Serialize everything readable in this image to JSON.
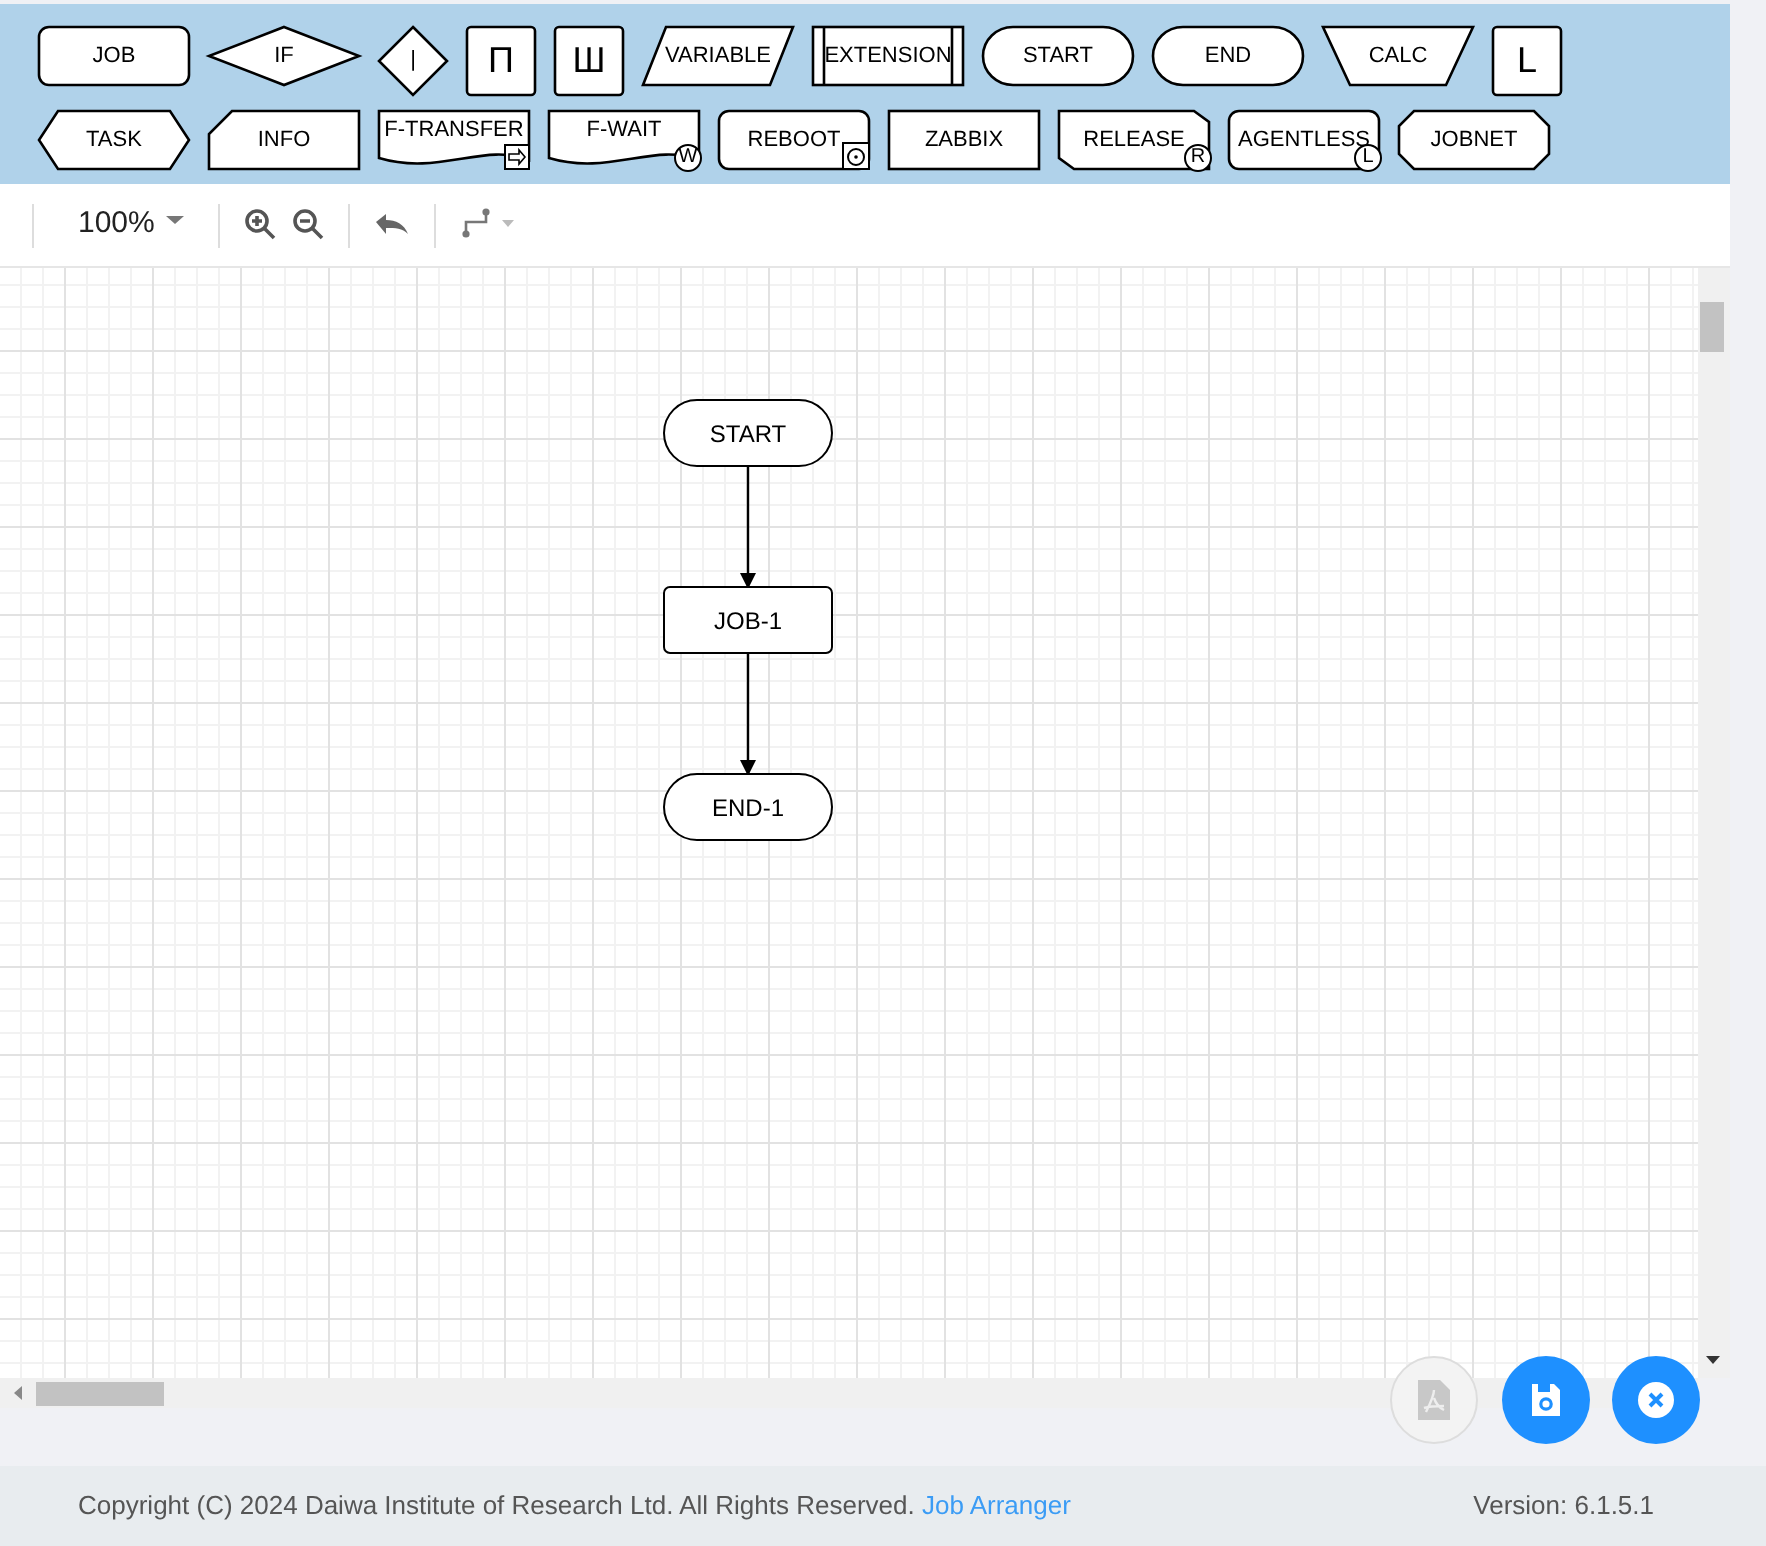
{
  "palette": {
    "top_row": [
      {
        "kind": "job",
        "label": "JOB"
      },
      {
        "kind": "if",
        "label": "IF"
      },
      {
        "kind": "branch",
        "label": "|"
      },
      {
        "kind": "loop",
        "label": "П"
      },
      {
        "kind": "loop",
        "label": "Ш"
      },
      {
        "kind": "variable",
        "label": "VARIABLE"
      },
      {
        "kind": "extension",
        "label": "EXTENSION"
      },
      {
        "kind": "start",
        "label": "START"
      },
      {
        "kind": "end",
        "label": "END"
      },
      {
        "kind": "calc",
        "label": "CALC"
      },
      {
        "kind": "loop",
        "label": "L"
      }
    ],
    "bottom_row": [
      {
        "kind": "task",
        "label": "TASK"
      },
      {
        "kind": "info",
        "label": "INFO"
      },
      {
        "kind": "ftransfer",
        "label": "F-TRANSFER"
      },
      {
        "kind": "fwait",
        "label": "F-WAIT",
        "badge": "W"
      },
      {
        "kind": "reboot",
        "label": "REBOOT"
      },
      {
        "kind": "zabbix",
        "label": "ZABBIX"
      },
      {
        "kind": "release",
        "label": "RELEASE",
        "badge": "R"
      },
      {
        "kind": "agentless",
        "label": "AGENTLESS",
        "badge": "L"
      },
      {
        "kind": "jobnet",
        "label": "JOBNET"
      }
    ]
  },
  "toolbar": {
    "zoom": "100%"
  },
  "canvas": {
    "nodes": [
      {
        "kind": "start",
        "label": "START"
      },
      {
        "kind": "job",
        "label": "JOB-1"
      },
      {
        "kind": "end",
        "label": "END-1"
      }
    ]
  },
  "actions": [
    {
      "kind": "pdf",
      "disabled": true
    },
    {
      "kind": "save",
      "disabled": false
    },
    {
      "kind": "close",
      "disabled": false
    }
  ],
  "footer": {
    "copyright": "Copyright (C) 2024 Daiwa Institute of Research Ltd. All Rights Reserved.",
    "link": "Job Arranger",
    "version": "Version: 6.1.5.1"
  }
}
